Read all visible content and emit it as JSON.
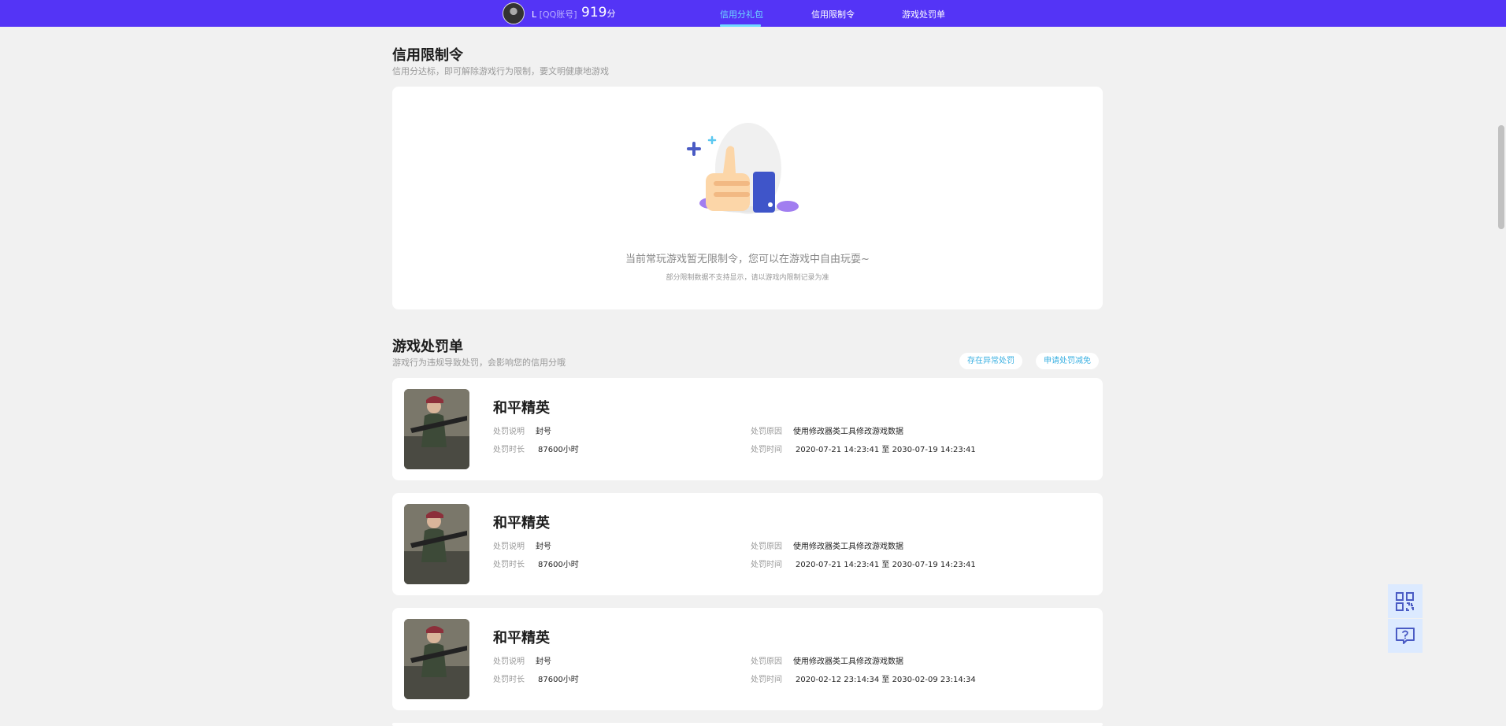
{
  "header": {
    "user_name": "L",
    "account_tag": "[QQ账号]",
    "score": "919",
    "score_unit": "分",
    "tabs": [
      {
        "label": "信用分礼包",
        "active": true
      },
      {
        "label": "信用限制令",
        "active": false
      },
      {
        "label": "游戏处罚单",
        "active": false
      }
    ]
  },
  "restriction": {
    "title": "信用限制令",
    "subtitle": "信用分达标，即可解除游戏行为限制，要文明健康地游戏",
    "empty_text": "当前常玩游戏暂无限制令，您可以在游戏中自由玩耍~",
    "empty_note": "部分限制数据不支持显示，请以游戏内限制记录为准"
  },
  "penalty": {
    "title": "游戏处罚单",
    "subtitle": "游戏行为违规导致处罚，会影响您的信用分哦",
    "buttons": {
      "abnormal": "存在异常处罚",
      "apply": "申请处罚减免"
    },
    "labels": {
      "desc": "处罚说明",
      "duration": "处罚时长",
      "reason": "处罚原因",
      "time": "处罚时间"
    },
    "items": [
      {
        "game": "和平精英",
        "desc": "封号",
        "duration": "87600小时",
        "reason": "使用修改器类工具修改游戏数据",
        "time": "2020-07-21 14:23:41 至 2030-07-19 14:23:41"
      },
      {
        "game": "和平精英",
        "desc": "封号",
        "duration": "87600小时",
        "reason": "使用修改器类工具修改游戏数据",
        "time": "2020-07-21 14:23:41 至 2030-07-19 14:23:41"
      },
      {
        "game": "和平精英",
        "desc": "封号",
        "duration": "87600小时",
        "reason": "使用修改器类工具修改游戏数据",
        "time": "2020-02-12 23:14:34 至 2030-02-09 23:14:34"
      }
    ]
  },
  "colors": {
    "header_bg": "#5434f6",
    "active_tab": "#6fd9ff",
    "link": "#3ab0e2"
  },
  "icons": [
    "avatar",
    "thumbs-up-illustration",
    "qr-code-icon",
    "help-feedback-icon"
  ]
}
